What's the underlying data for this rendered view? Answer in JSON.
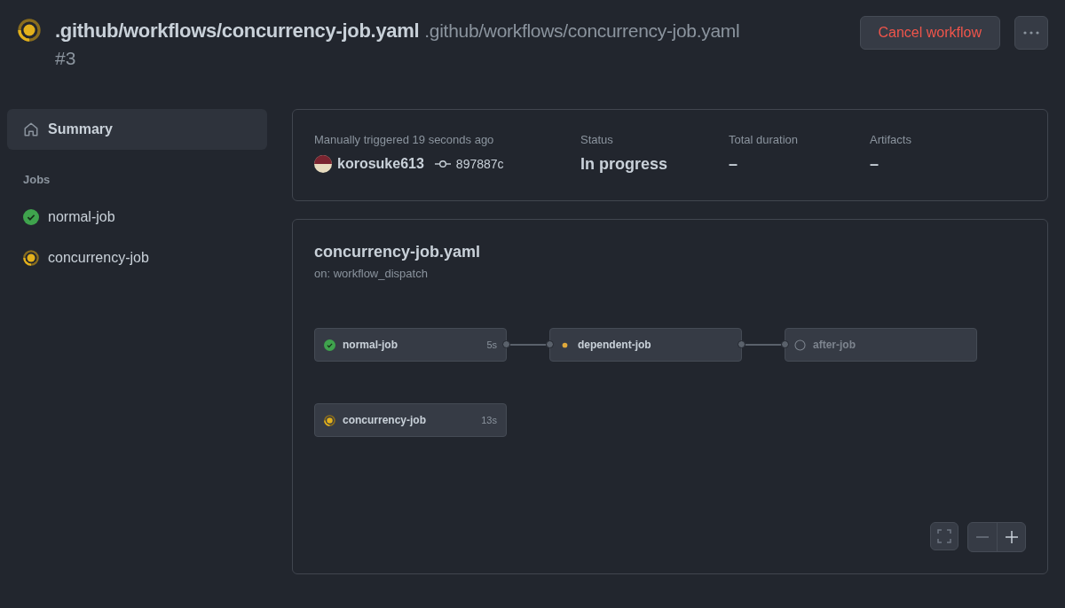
{
  "header": {
    "kind": "in_progress",
    "title": ".github/workflows/concurrency-job.yaml",
    "subtitle": ".github/workflows/concurrency-job.yaml",
    "run_number": "#3",
    "cancel_button": "Cancel workflow"
  },
  "sidebar": {
    "summary": {
      "label": "Summary",
      "selected": true
    },
    "jobs_heading": "Jobs",
    "jobs": [
      {
        "name": "normal-job",
        "kind": "success",
        "selected": false
      },
      {
        "name": "concurrency-job",
        "kind": "in_progress",
        "selected": false
      }
    ]
  },
  "summary": {
    "trigger": "Manually triggered 19 seconds ago",
    "actor": "korosuke613",
    "commit": "897887c",
    "fields": [
      {
        "label": "Status",
        "value": "In progress"
      },
      {
        "label": "Total duration",
        "value": "–"
      },
      {
        "label": "Artifacts",
        "value": "–"
      }
    ]
  },
  "graph": {
    "title": "concurrency-job.yaml",
    "trigger": "on: workflow_dispatch",
    "chains": [
      [
        {
          "name": "normal-job",
          "kind": "success",
          "duration": "5s"
        },
        {
          "name": "dependent-job",
          "kind": "queued"
        },
        {
          "name": "after-job",
          "kind": "pending"
        }
      ],
      [
        {
          "name": "concurrency-job",
          "kind": "in_progress",
          "duration": "13s"
        }
      ]
    ]
  }
}
